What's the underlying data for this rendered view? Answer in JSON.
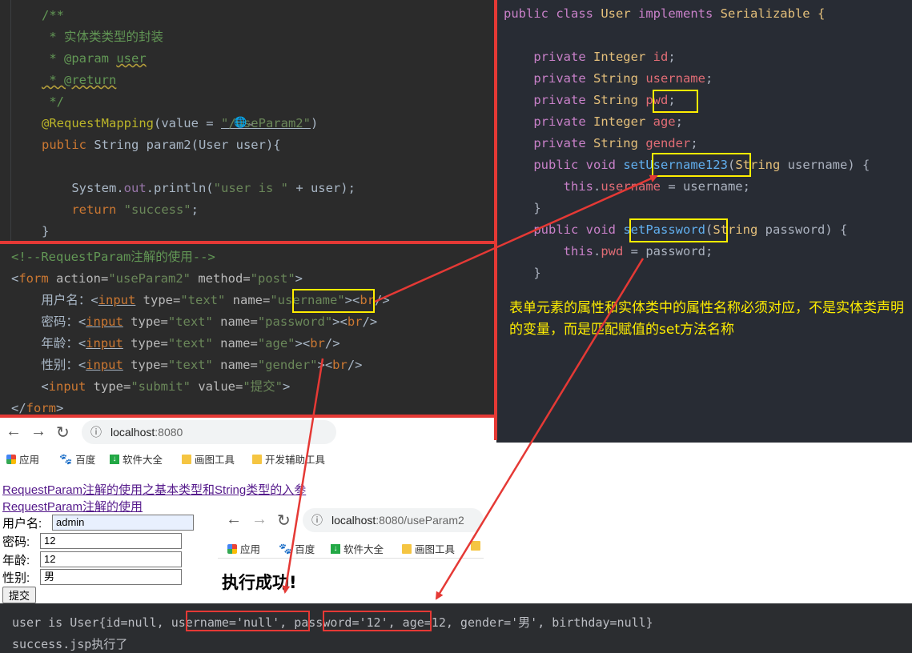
{
  "java_controller": {
    "lines": [
      {
        "parts": [
          {
            "t": "/**",
            "c": "c-comment"
          }
        ]
      },
      {
        "parts": [
          {
            "t": " * 实体类类型的封装",
            "c": "c-comment"
          }
        ]
      },
      {
        "parts": [
          {
            "t": " * @param ",
            "c": "c-comment"
          },
          {
            "t": "user",
            "c": "c-comment wavy"
          }
        ]
      },
      {
        "parts": [
          {
            "t": " * @return",
            "c": "c-comment wavy"
          }
        ]
      },
      {
        "parts": [
          {
            "t": " */",
            "c": "c-comment"
          }
        ]
      },
      {
        "parts": [
          {
            "t": "@RequestMapping",
            "c": "c-annot"
          },
          {
            "t": "(value = ",
            "c": "c-plain"
          },
          {
            "t": "\"/useParam2\"",
            "c": "c-str underline"
          },
          {
            "t": ")",
            "c": "c-plain"
          }
        ]
      },
      {
        "parts": [
          {
            "t": "public ",
            "c": "c-kw"
          },
          {
            "t": "String param2(User user){",
            "c": "c-plain"
          }
        ]
      },
      {
        "parts": [
          {
            "t": "",
            "c": "c-plain"
          }
        ]
      },
      {
        "parts": [
          {
            "t": "    System.",
            "c": "c-plain"
          },
          {
            "t": "out",
            "c": "c-field"
          },
          {
            "t": ".println(",
            "c": "c-plain"
          },
          {
            "t": "\"user is \"",
            "c": "c-str"
          },
          {
            "t": " + user);",
            "c": "c-plain"
          }
        ]
      },
      {
        "parts": [
          {
            "t": "    return ",
            "c": "c-kw"
          },
          {
            "t": "\"success\"",
            "c": "c-str"
          },
          {
            "t": ";",
            "c": "c-plain"
          }
        ]
      },
      {
        "parts": [
          {
            "t": "}",
            "c": "c-plain"
          }
        ]
      }
    ],
    "globe_hint": "🌐⌄"
  },
  "java_entity": {
    "lines": [
      {
        "parts": [
          {
            "t": "public ",
            "c": "c-kw2"
          },
          {
            "t": "class ",
            "c": "c-kw2"
          },
          {
            "t": "User ",
            "c": "c-id"
          },
          {
            "t": "implements ",
            "c": "c-kw2"
          },
          {
            "t": "Serializable {",
            "c": "c-id"
          }
        ]
      },
      {
        "parts": [
          {
            "t": "",
            "c": "c-ide"
          }
        ]
      },
      {
        "parts": [
          {
            "t": "    private ",
            "c": "c-kw2"
          },
          {
            "t": "Integer ",
            "c": "c-id"
          },
          {
            "t": "id",
            "c": "c-fn2"
          },
          {
            "t": ";",
            "c": "c-ide"
          }
        ]
      },
      {
        "parts": [
          {
            "t": "    private ",
            "c": "c-kw2"
          },
          {
            "t": "String ",
            "c": "c-id"
          },
          {
            "t": "username",
            "c": "c-fn2"
          },
          {
            "t": ";",
            "c": "c-ide"
          }
        ]
      },
      {
        "parts": [
          {
            "t": "    private ",
            "c": "c-kw2"
          },
          {
            "t": "String ",
            "c": "c-id"
          },
          {
            "t": "pwd",
            "c": "c-fn2"
          },
          {
            "t": ";",
            "c": "c-ide"
          }
        ]
      },
      {
        "parts": [
          {
            "t": "    private ",
            "c": "c-kw2"
          },
          {
            "t": "Integer ",
            "c": "c-id"
          },
          {
            "t": "age",
            "c": "c-fn2"
          },
          {
            "t": ";",
            "c": "c-ide"
          }
        ]
      },
      {
        "parts": [
          {
            "t": "    private ",
            "c": "c-kw2"
          },
          {
            "t": "String ",
            "c": "c-id"
          },
          {
            "t": "gender",
            "c": "c-fn2"
          },
          {
            "t": ";",
            "c": "c-ide"
          }
        ]
      },
      {
        "parts": [
          {
            "t": "    public ",
            "c": "c-kw2"
          },
          {
            "t": "void ",
            "c": "c-kw2"
          },
          {
            "t": "setUsername123",
            "c": "c-fn"
          },
          {
            "t": "(",
            "c": "c-ide"
          },
          {
            "t": "String ",
            "c": "c-id"
          },
          {
            "t": "username",
            "c": "c-ide"
          },
          {
            "t": ") {",
            "c": "c-ide"
          }
        ]
      },
      {
        "parts": [
          {
            "t": "        this",
            "c": "c-kw2"
          },
          {
            "t": ".",
            "c": "c-ide"
          },
          {
            "t": "username",
            "c": "c-fn2"
          },
          {
            "t": " = username;",
            "c": "c-ide"
          }
        ]
      },
      {
        "parts": [
          {
            "t": "    }",
            "c": "c-ide"
          }
        ]
      },
      {
        "parts": [
          {
            "t": "    public ",
            "c": "c-kw2"
          },
          {
            "t": "void ",
            "c": "c-kw2"
          },
          {
            "t": "setPassword",
            "c": "c-fn"
          },
          {
            "t": "(",
            "c": "c-ide"
          },
          {
            "t": "String ",
            "c": "c-id"
          },
          {
            "t": "password",
            "c": "c-ide"
          },
          {
            "t": ") {",
            "c": "c-ide"
          }
        ]
      },
      {
        "parts": [
          {
            "t": "        this",
            "c": "c-kw2"
          },
          {
            "t": ".",
            "c": "c-ide"
          },
          {
            "t": "pwd",
            "c": "c-fn2"
          },
          {
            "t": " = password;",
            "c": "c-ide"
          }
        ]
      },
      {
        "parts": [
          {
            "t": "    }",
            "c": "c-ide"
          }
        ]
      }
    ]
  },
  "annotation_note": "表单元素的属性和实体类中的属性名称必须对应，不是实体类声明的变量，而是匹配赋值的set方法名称",
  "html_form": {
    "lines": [
      {
        "parts": [
          {
            "t": "<!--RequestParam注解的使用-->",
            "c": "c-comment"
          }
        ]
      },
      {
        "parts": [
          {
            "t": "<",
            "c": "c-plain"
          },
          {
            "t": "form ",
            "c": "c-kw"
          },
          {
            "t": "action=",
            "c": "c-attr"
          },
          {
            "t": "\"useParam2\"",
            "c": "c-str"
          },
          {
            "t": " method=",
            "c": "c-attr"
          },
          {
            "t": "\"post\"",
            "c": "c-str"
          },
          {
            "t": ">",
            "c": "c-plain"
          }
        ]
      },
      {
        "parts": [
          {
            "t": "    用户名：<",
            "c": "c-plain"
          },
          {
            "t": "input",
            "c": "c-kw underline"
          },
          {
            "t": " type=",
            "c": "c-attr"
          },
          {
            "t": "\"text\"",
            "c": "c-str"
          },
          {
            "t": " name=",
            "c": "c-attr"
          },
          {
            "t": "\"username\"",
            "c": "c-str"
          },
          {
            "t": "><",
            "c": "c-plain"
          },
          {
            "t": "br",
            "c": "c-kw"
          },
          {
            "t": "/>",
            "c": "c-plain"
          }
        ]
      },
      {
        "parts": [
          {
            "t": "    密码：<",
            "c": "c-plain"
          },
          {
            "t": "input",
            "c": "c-kw underline"
          },
          {
            "t": " type=",
            "c": "c-attr"
          },
          {
            "t": "\"text\"",
            "c": "c-str"
          },
          {
            "t": " name=",
            "c": "c-attr"
          },
          {
            "t": "\"password\"",
            "c": "c-str"
          },
          {
            "t": "><",
            "c": "c-plain"
          },
          {
            "t": "br",
            "c": "c-kw"
          },
          {
            "t": "/>",
            "c": "c-plain"
          }
        ]
      },
      {
        "parts": [
          {
            "t": "    年龄：<",
            "c": "c-plain"
          },
          {
            "t": "input",
            "c": "c-kw underline"
          },
          {
            "t": " type=",
            "c": "c-attr"
          },
          {
            "t": "\"text\"",
            "c": "c-str"
          },
          {
            "t": " name=",
            "c": "c-attr"
          },
          {
            "t": "\"age\"",
            "c": "c-str"
          },
          {
            "t": "><",
            "c": "c-plain"
          },
          {
            "t": "br",
            "c": "c-kw"
          },
          {
            "t": "/>",
            "c": "c-plain"
          }
        ]
      },
      {
        "parts": [
          {
            "t": "    性别：<",
            "c": "c-plain"
          },
          {
            "t": "input",
            "c": "c-kw underline"
          },
          {
            "t": " type=",
            "c": "c-attr"
          },
          {
            "t": "\"text\"",
            "c": "c-str"
          },
          {
            "t": " name=",
            "c": "c-attr"
          },
          {
            "t": "\"gender\"",
            "c": "c-str"
          },
          {
            "t": "><",
            "c": "c-plain"
          },
          {
            "t": "br",
            "c": "c-kw"
          },
          {
            "t": "/>",
            "c": "c-plain"
          }
        ]
      },
      {
        "parts": [
          {
            "t": "    <",
            "c": "c-plain"
          },
          {
            "t": "input ",
            "c": "c-kw"
          },
          {
            "t": "type=",
            "c": "c-attr"
          },
          {
            "t": "\"submit\"",
            "c": "c-str"
          },
          {
            "t": " value=",
            "c": "c-attr"
          },
          {
            "t": "\"提交\"",
            "c": "c-str"
          },
          {
            "t": ">",
            "c": "c-plain"
          }
        ]
      },
      {
        "parts": [
          {
            "t": "</",
            "c": "c-plain"
          },
          {
            "t": "form",
            "c": "c-kw"
          },
          {
            "t": ">",
            "c": "c-plain"
          }
        ]
      }
    ]
  },
  "browser1": {
    "url_host": "localhost",
    "url_rest": ":8080",
    "bookmarks": [
      "应用",
      "百度",
      "软件大全",
      "画图工具",
      "开发辅助工具"
    ],
    "link1": "RequestParam注解的使用之基本类型和String类型的入参",
    "link2": "RequestParam注解的使用",
    "fields": [
      {
        "label": "用户名:",
        "value": "admin"
      },
      {
        "label": "密码:",
        "value": "12"
      },
      {
        "label": "年龄:",
        "value": "12"
      },
      {
        "label": "性别:",
        "value": "男"
      }
    ],
    "submit": "提交"
  },
  "browser2": {
    "url_host": "localhost",
    "url_rest": ":8080/useParam2",
    "bookmarks": [
      "应用",
      "百度",
      "软件大全",
      "画图工具"
    ],
    "result": "执行成功!"
  },
  "console": {
    "line1_prefix": "user is User{id=null, ",
    "line1_username": "username='null'",
    "line1_sep": ", ",
    "line1_password": "password='12'",
    "line1_suffix": ", age=12, gender='男', birthday=null}",
    "line2": "success.jsp执行了"
  },
  "colors": {
    "highlight_box": "#ffee00",
    "arrow_red": "#e53935",
    "note_text": "#ffee00"
  }
}
